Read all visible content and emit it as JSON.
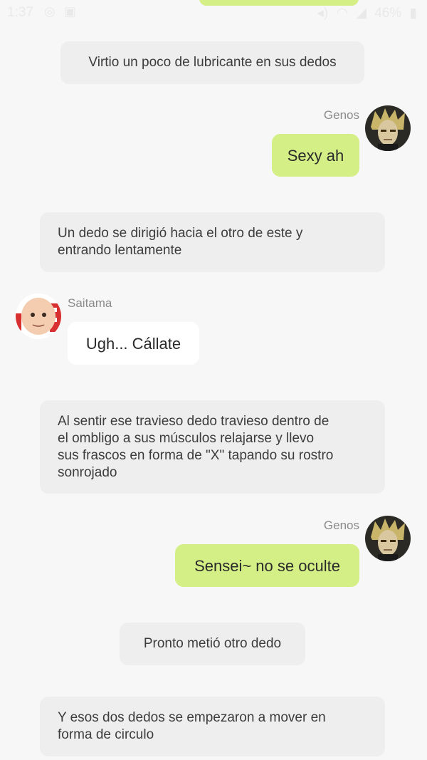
{
  "status_bar": {
    "time": "1:37",
    "battery": "46%",
    "left_icons": [
      "whatsapp-icon",
      "gallery-icon"
    ],
    "right_icons": [
      "mute-icon",
      "wifi-icon",
      "signal-icon",
      "battery-icon"
    ]
  },
  "messages": [
    {
      "kind": "narration",
      "text": "Virtio un poco de lubricante en sus dedos"
    },
    {
      "kind": "outgoing",
      "sender": "Genos",
      "text": "Sexy ah"
    },
    {
      "kind": "narration",
      "text_lines": [
        "Un dedo se dirigió hacia el otro de este y",
        "entrando lentamente"
      ]
    },
    {
      "kind": "incoming",
      "sender": "Saitama",
      "text": "Ugh... Cállate"
    },
    {
      "kind": "narration",
      "text_lines": [
        "Al sentir ese travieso dedo travieso dentro de",
        "el ombligo a sus músculos relajarse y llevo",
        "sus frascos en forma de \"X\" tapando su rostro",
        "sonrojado"
      ]
    },
    {
      "kind": "outgoing",
      "sender": "Genos",
      "text": "Sensei~ no se oculte"
    },
    {
      "kind": "narration",
      "text": "Pronto metió otro dedo"
    },
    {
      "kind": "narration",
      "text_lines": [
        "Y esos dos dedos se empezaron a mover en",
        "forma de circulo"
      ]
    }
  ],
  "colors": {
    "background": "#f7f7f7",
    "narration_bubble": "#eeeeee",
    "outgoing_bubble": "#d4ef86",
    "incoming_bubble": "#ffffff",
    "sender_name": "#8a8a8a"
  }
}
